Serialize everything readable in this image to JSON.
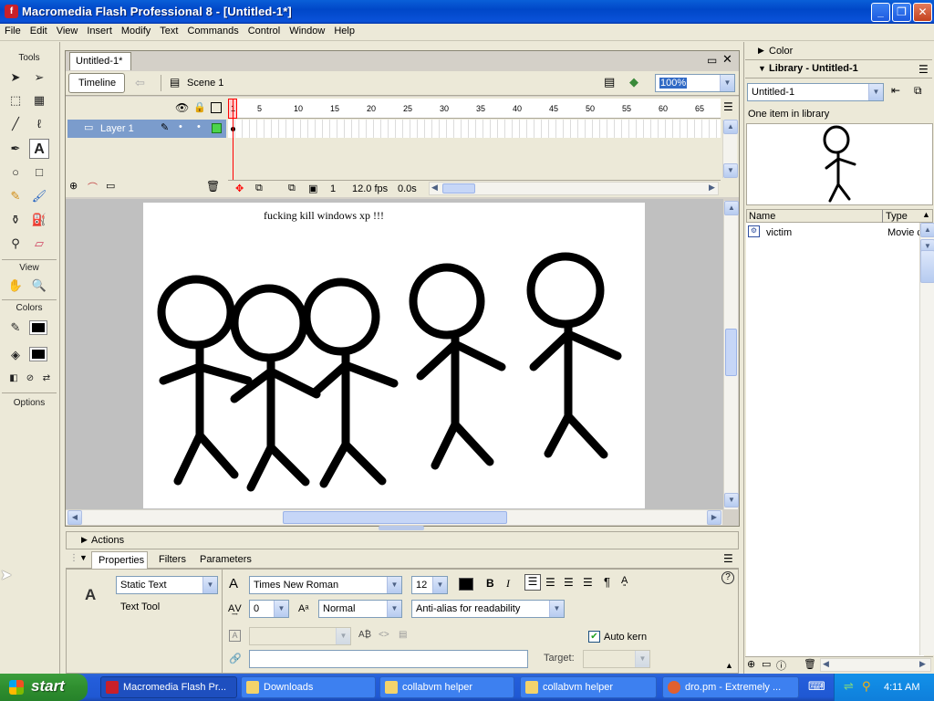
{
  "window": {
    "title": "Macromedia Flash Professional 8 - [Untitled-1*]",
    "app_icon": "flash-icon",
    "buttons": [
      "minimize",
      "restore",
      "close"
    ]
  },
  "menu": [
    "File",
    "Edit",
    "View",
    "Insert",
    "Modify",
    "Text",
    "Commands",
    "Control",
    "Window",
    "Help"
  ],
  "tools": {
    "label": "Tools",
    "view_label": "View",
    "colors_label": "Colors",
    "options_label": "Options",
    "icons": [
      "arrow-tool-icon",
      "subselect-tool-icon",
      "free-transform-icon",
      "gradient-transform-icon",
      "line-tool-icon",
      "lasso-tool-icon",
      "pen-tool-icon",
      "text-tool-icon",
      "oval-tool-icon",
      "rectangle-tool-icon",
      "pencil-tool-icon",
      "brush-tool-icon",
      "ink-bottle-icon",
      "paint-bucket-icon",
      "eyedropper-icon",
      "eraser-icon",
      "hand-tool-icon",
      "zoom-tool-icon"
    ]
  },
  "document": {
    "tab": "Untitled-1*",
    "timeline_button": "Timeline",
    "scene": "Scene 1",
    "zoom": "100%",
    "layer_name": "Layer 1",
    "ruler_ticks": [
      "1",
      "5",
      "10",
      "15",
      "20",
      "25",
      "30",
      "35",
      "40",
      "45",
      "50",
      "55",
      "60",
      "65"
    ],
    "current_frame": "1",
    "fps": "12.0 fps",
    "time": "0.0s",
    "stage_text": "fucking kill windows xp !!!",
    "stage_drawing": "five-stick-figures"
  },
  "panels": {
    "actions": "Actions",
    "tabs": [
      "Properties",
      "Filters",
      "Parameters"
    ],
    "text_type": "Static Text",
    "tool_name": "Text Tool",
    "font": "Times New Roman",
    "font_size": "12",
    "letter_spacing": "0",
    "position": "Normal",
    "antialias": "Anti-alias for readability",
    "auto_kern": "Auto kern",
    "target_label": "Target:",
    "help": "?"
  },
  "right": {
    "color": "Color",
    "library_title": "Library - Untitled-1",
    "library_doc": "Untitled-1",
    "item_count": "One item in library",
    "col_name": "Name",
    "col_type": "Type",
    "item_name": "victim",
    "item_type": "Movie c"
  },
  "taskbar": {
    "start": "start",
    "tasks": [
      "Macromedia Flash Pr...",
      "Downloads",
      "collabvm helper",
      "collabvm helper",
      "dro.pm - Extremely ..."
    ],
    "time": "4:11 AM"
  },
  "colors": {
    "accent": "#0a52d9",
    "start_green": "#2f8e2f",
    "flash_red": "#c8202a",
    "playhead": "#ff0000"
  }
}
